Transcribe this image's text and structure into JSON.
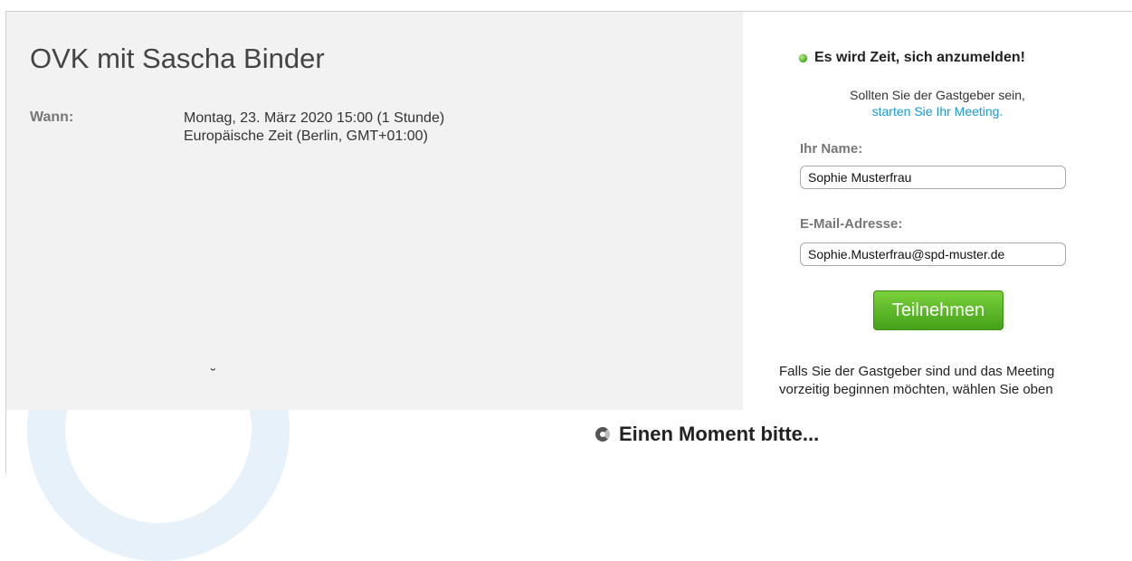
{
  "meeting": {
    "title": "OVK mit Sascha Binder",
    "when_label": "Wann:",
    "when_line1": "Montag, 23. März 2020 15:00 (1 Stunde)",
    "when_line2": "Europäische Zeit (Berlin, GMT+01:00)",
    "stray_mark": "˘"
  },
  "join": {
    "status": "Es wird Zeit, sich anzumelden!",
    "status_color": "#4aa51d",
    "host_prompt": "Sollten Sie der Gastgeber sein,",
    "host_link": "starten Sie Ihr Meeting.",
    "name_label": "Ihr Name:",
    "name_value": "Sophie Musterfrau",
    "email_label": "E-Mail-Adresse:",
    "email_value": "Sophie.Musterfrau@spd-muster.de",
    "button_label": "Teilnehmen",
    "button_color": "#45a11a",
    "info_line1": "Falls Sie der Gastgeber sind und das Meeting",
    "info_line2": "vorzeitig beginnen möchten, wählen Sie oben"
  },
  "loading": {
    "text": "Einen Moment bitte...",
    "icon": "spinner-icon"
  },
  "colors": {
    "link": "#1a9ad6",
    "panel_bg": "#f2f2f2"
  }
}
